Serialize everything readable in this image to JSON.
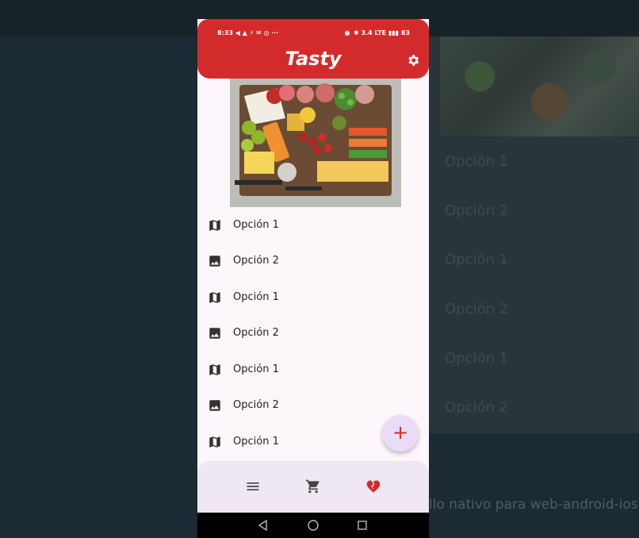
{
  "background_app": {
    "items": [
      "Opción 1",
      "Opción 2",
      "Opción 1",
      "Opción 2",
      "Opción 1",
      "Opción 2"
    ],
    "footer_text": "llo nativo para web-android-ios"
  },
  "status_bar": {
    "time": "8:33",
    "left_icons": "◀ ▲ ⚡ ✉ ◎ ···",
    "right_icons": "⏰ ✱ 3.4 LTE ▮▮▮ 83"
  },
  "app": {
    "title": "Tasty",
    "settings_icon": "gear-icon",
    "accent": "#d32b2b"
  },
  "list": [
    {
      "icon": "map-icon",
      "label": "Opción 1"
    },
    {
      "icon": "image-icon",
      "label": "Opción 2"
    },
    {
      "icon": "map-icon",
      "label": "Opción 1"
    },
    {
      "icon": "image-icon",
      "label": "Opción 2"
    },
    {
      "icon": "map-icon",
      "label": "Opción 1"
    },
    {
      "icon": "image-icon",
      "label": "Opción 2"
    },
    {
      "icon": "map-icon",
      "label": "Opción 1"
    }
  ],
  "fab": {
    "label": "+"
  },
  "bottom_nav": [
    {
      "icon": "menu-icon"
    },
    {
      "icon": "cart-icon"
    },
    {
      "icon": "heart-broken-icon"
    }
  ],
  "system_nav": [
    "back-icon",
    "home-icon",
    "recents-icon"
  ]
}
